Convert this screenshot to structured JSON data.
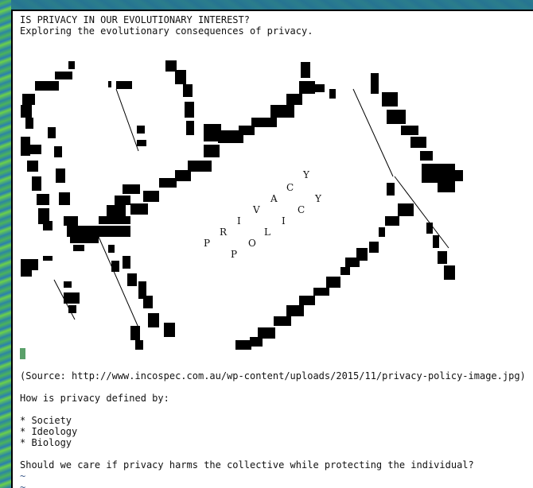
{
  "header": {
    "title": "IS PRIVACY IN OUR EVOLUTIONARY INTEREST?",
    "subtitle": "Exploring the evolutionary consequences of privacy."
  },
  "artwork": {
    "icon": "privacy-policy-ascii-image",
    "scattered_letters": [
      "Y",
      "C",
      "A",
      "Y",
      "V",
      "C",
      "I",
      "I",
      "R",
      "L",
      "P",
      "O",
      "P"
    ]
  },
  "body": {
    "source_line": "(Source: http://www.incospec.com.au/wp-content/uploads/2015/11/privacy-policy-image.jpg)",
    "question_intro": "How is privacy defined by:",
    "bullets": [
      "* Society",
      "* Ideology",
      "* Biology"
    ],
    "closing_question": "Should we care if privacy harms the collective while protecting the individual?",
    "tildes": [
      "~",
      "~"
    ]
  },
  "colors": {
    "cursor": "#5aa06a",
    "tilde": "#3c5a8a",
    "text": "#111111",
    "background": "#ffffff"
  }
}
